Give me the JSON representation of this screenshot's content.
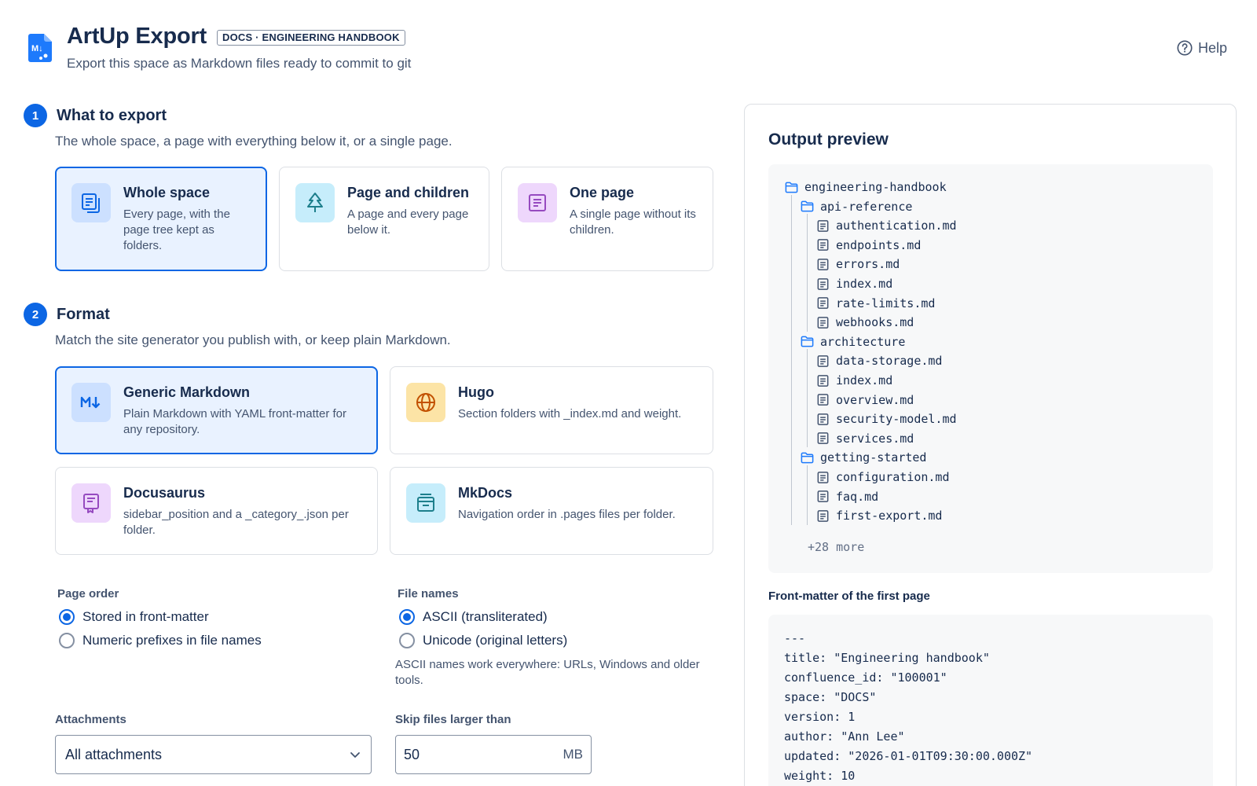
{
  "header": {
    "title": "ArtUp Export",
    "space_badge": "DOCS · ENGINEERING HANDBOOK",
    "subtitle": "Export this space as Markdown files ready to commit to git",
    "help_label": "Help"
  },
  "steps": [
    {
      "number": "1",
      "title": "What to export",
      "description": "The whole space, a page with everything below it, or a single page."
    },
    {
      "number": "2",
      "title": "Format",
      "description": "Match the site generator you publish with, or keep plain Markdown."
    }
  ],
  "scope_options": [
    {
      "title": "Whole space",
      "description": "Every page, with the page tree kept as folders.",
      "selected": true
    },
    {
      "title": "Page and children",
      "description": "A page and every page below it.",
      "selected": false
    },
    {
      "title": "One page",
      "description": "A single page without its children.",
      "selected": false
    }
  ],
  "format_options": [
    {
      "title": "Generic Markdown",
      "description": "Plain Markdown with YAML front-matter for any repository.",
      "selected": true
    },
    {
      "title": "Hugo",
      "description": "Section folders with _index.md and weight.",
      "selected": false
    },
    {
      "title": "Docusaurus",
      "description": "sidebar_position and a _category_.json per folder.",
      "selected": false
    },
    {
      "title": "MkDocs",
      "description": "Navigation order in .pages files per folder.",
      "selected": false
    }
  ],
  "page_order": {
    "label": "Page order",
    "options": [
      {
        "label": "Stored in front-matter",
        "checked": true
      },
      {
        "label": "Numeric prefixes in file names",
        "checked": false
      }
    ]
  },
  "file_names": {
    "label": "File names",
    "options": [
      {
        "label": "ASCII (transliterated)",
        "checked": true
      },
      {
        "label": "Unicode (original letters)",
        "checked": false
      }
    ],
    "hint": "ASCII names work everywhere: URLs, Windows and older tools."
  },
  "attachments": {
    "label": "Attachments",
    "value": "All attachments"
  },
  "skip_files": {
    "label": "Skip files larger than",
    "value": "50",
    "unit": "MB"
  },
  "preview": {
    "title": "Output preview",
    "root": "engineering-handbook",
    "folders": [
      {
        "name": "api-reference",
        "files": [
          "authentication.md",
          "endpoints.md",
          "errors.md",
          "index.md",
          "rate-limits.md",
          "webhooks.md"
        ]
      },
      {
        "name": "architecture",
        "files": [
          "data-storage.md",
          "index.md",
          "overview.md",
          "security-model.md",
          "services.md"
        ]
      },
      {
        "name": "getting-started",
        "files": [
          "configuration.md",
          "faq.md",
          "first-export.md"
        ]
      }
    ],
    "more": "+28 more",
    "front_matter_label": "Front-matter of the first page",
    "front_matter_lines": [
      "---",
      "title: \"Engineering handbook\"",
      "confluence_id: \"100001\"",
      "space: \"DOCS\"",
      "version: 1",
      "author: \"Ann Lee\"",
      "updated: \"2026-01-01T09:30:00.000Z\"",
      "weight: 10"
    ]
  },
  "colors": {
    "accent": "#0c66e4",
    "selected_bg": "#e9f2ff",
    "text": "#172b4d",
    "subtle_text": "#44546f"
  },
  "icons": {
    "logo": "markdown-file-icon",
    "help": "question-circle-icon",
    "whole_space": "pages-stack-icon",
    "page_and_children": "tree-icon",
    "one_page": "page-icon",
    "generic_markdown": "markdown-icon",
    "hugo": "globe-icon",
    "docusaurus": "book-icon",
    "mkdocs": "window-icon",
    "folder": "folder-icon",
    "file": "file-icon"
  }
}
